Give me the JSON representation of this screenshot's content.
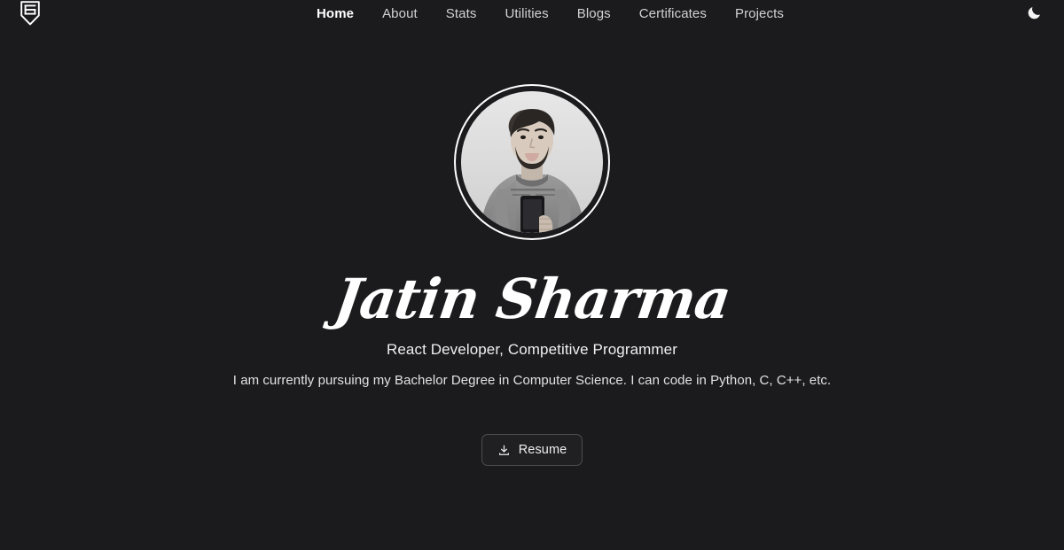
{
  "theme": {
    "background": "#1b1b1d",
    "text": "#e8e8e8",
    "accent": "#ffffff",
    "muted": "#d2d2d4",
    "border": "#4d4d51",
    "button_bg": "#202022"
  },
  "navbar": {
    "brand": {
      "name": "site-logo",
      "icon": "shield-badge-icon",
      "alt": "JS shield badge logo"
    },
    "links": [
      {
        "label": "Home",
        "active": true,
        "icon": "nav-home"
      },
      {
        "label": "About",
        "active": false,
        "icon": "nav-about"
      },
      {
        "label": "Stats",
        "active": false,
        "icon": "nav-stats"
      },
      {
        "label": "Utilities",
        "active": false,
        "icon": "nav-utilities"
      },
      {
        "label": "Blogs",
        "active": false,
        "icon": "nav-blogs"
      },
      {
        "label": "Certificates",
        "active": false,
        "icon": "nav-certificates"
      },
      {
        "label": "Projects",
        "active": false,
        "icon": "nav-projects"
      }
    ],
    "theme_toggle": {
      "icon": "moon-icon",
      "label": "Toggle dark mode"
    }
  },
  "hero": {
    "avatar": {
      "icon": "profile-photo",
      "alt": "Black and white photo of Jatin Sharma holding a phone"
    },
    "name": "Jatin Sharma",
    "tagline": "React Developer, Competitive Programmer",
    "description": "I am currently pursuing my Bachelor Degree in Computer Science. I can code in Python, C, C++, etc.",
    "resume_button": {
      "label": "Resume",
      "icon": "download-icon"
    }
  }
}
